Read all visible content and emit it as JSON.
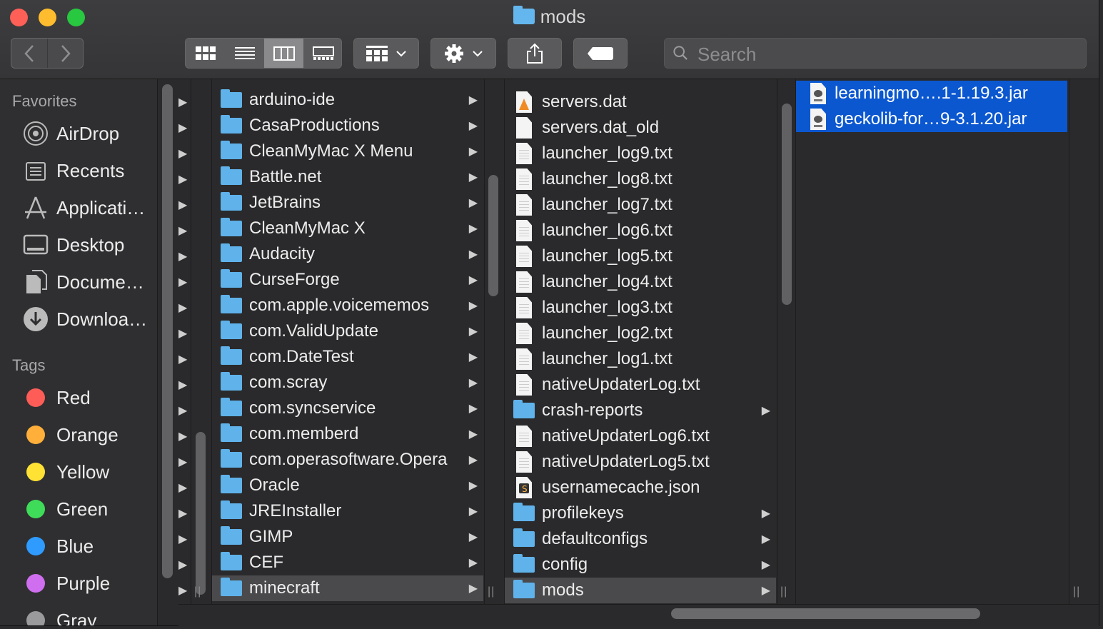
{
  "window": {
    "title": "mods"
  },
  "toolbar": {
    "back_icon": "chevron-left-icon",
    "forward_icon": "chevron-right-icon",
    "view_modes": [
      "icon-view",
      "list-view",
      "column-view",
      "gallery-view"
    ],
    "active_view": "column-view",
    "search_placeholder": "Search"
  },
  "sidebar": {
    "favorites_header": "Favorites",
    "favorites": [
      {
        "label": "AirDrop",
        "icon": "airdrop-icon"
      },
      {
        "label": "Recents",
        "icon": "recents-icon"
      },
      {
        "label": "Applicati…",
        "icon": "applications-icon"
      },
      {
        "label": "Desktop",
        "icon": "desktop-icon"
      },
      {
        "label": "Docume…",
        "icon": "documents-icon"
      },
      {
        "label": "Downloa…",
        "icon": "downloads-icon"
      }
    ],
    "tags_header": "Tags",
    "tags": [
      {
        "label": "Red",
        "color": "#fe5d57"
      },
      {
        "label": "Orange",
        "color": "#ffaf3a"
      },
      {
        "label": "Yellow",
        "color": "#ffe234"
      },
      {
        "label": "Green",
        "color": "#3fdc59"
      },
      {
        "label": "Blue",
        "color": "#2f9bff"
      },
      {
        "label": "Purple",
        "color": "#d06ef0"
      },
      {
        "label": "Gray",
        "color": "#9a9a9c"
      }
    ]
  },
  "column2": {
    "items": [
      "arduino-ide",
      "CasaProductions",
      "CleanMyMac X Menu",
      "Battle.net",
      "JetBrains",
      "CleanMyMac X",
      "Audacity",
      "CurseForge",
      "com.apple.voicememos",
      "com.ValidUpdate",
      "com.DateTest",
      "com.scray",
      "com.syncservice",
      "com.memberd",
      "com.operasoftware.Opera",
      "Oracle",
      "JREInstaller",
      "GIMP",
      "CEF",
      "minecraft"
    ],
    "selected": "minecraft"
  },
  "column3": {
    "items": [
      {
        "name": "servers.dat",
        "type": "dat"
      },
      {
        "name": "servers.dat_old",
        "type": "blank"
      },
      {
        "name": "launcher_log9.txt",
        "type": "txt"
      },
      {
        "name": "launcher_log8.txt",
        "type": "txt"
      },
      {
        "name": "launcher_log7.txt",
        "type": "txt"
      },
      {
        "name": "launcher_log6.txt",
        "type": "txt"
      },
      {
        "name": "launcher_log5.txt",
        "type": "txt"
      },
      {
        "name": "launcher_log4.txt",
        "type": "txt"
      },
      {
        "name": "launcher_log3.txt",
        "type": "txt"
      },
      {
        "name": "launcher_log2.txt",
        "type": "txt"
      },
      {
        "name": "launcher_log1.txt",
        "type": "txt"
      },
      {
        "name": "nativeUpdaterLog.txt",
        "type": "txt"
      },
      {
        "name": "crash-reports",
        "type": "folder"
      },
      {
        "name": "nativeUpdaterLog6.txt",
        "type": "txt"
      },
      {
        "name": "nativeUpdaterLog5.txt",
        "type": "txt"
      },
      {
        "name": "usernamecache.json",
        "type": "json"
      },
      {
        "name": "profilekeys",
        "type": "folder"
      },
      {
        "name": "defaultconfigs",
        "type": "folder"
      },
      {
        "name": "config",
        "type": "folder"
      },
      {
        "name": "mods",
        "type": "folder"
      }
    ],
    "selected": "mods"
  },
  "column4": {
    "items": [
      "learningmo….1-1.19.3.jar",
      "geckolib-for…9-3.1.20.jar"
    ]
  }
}
